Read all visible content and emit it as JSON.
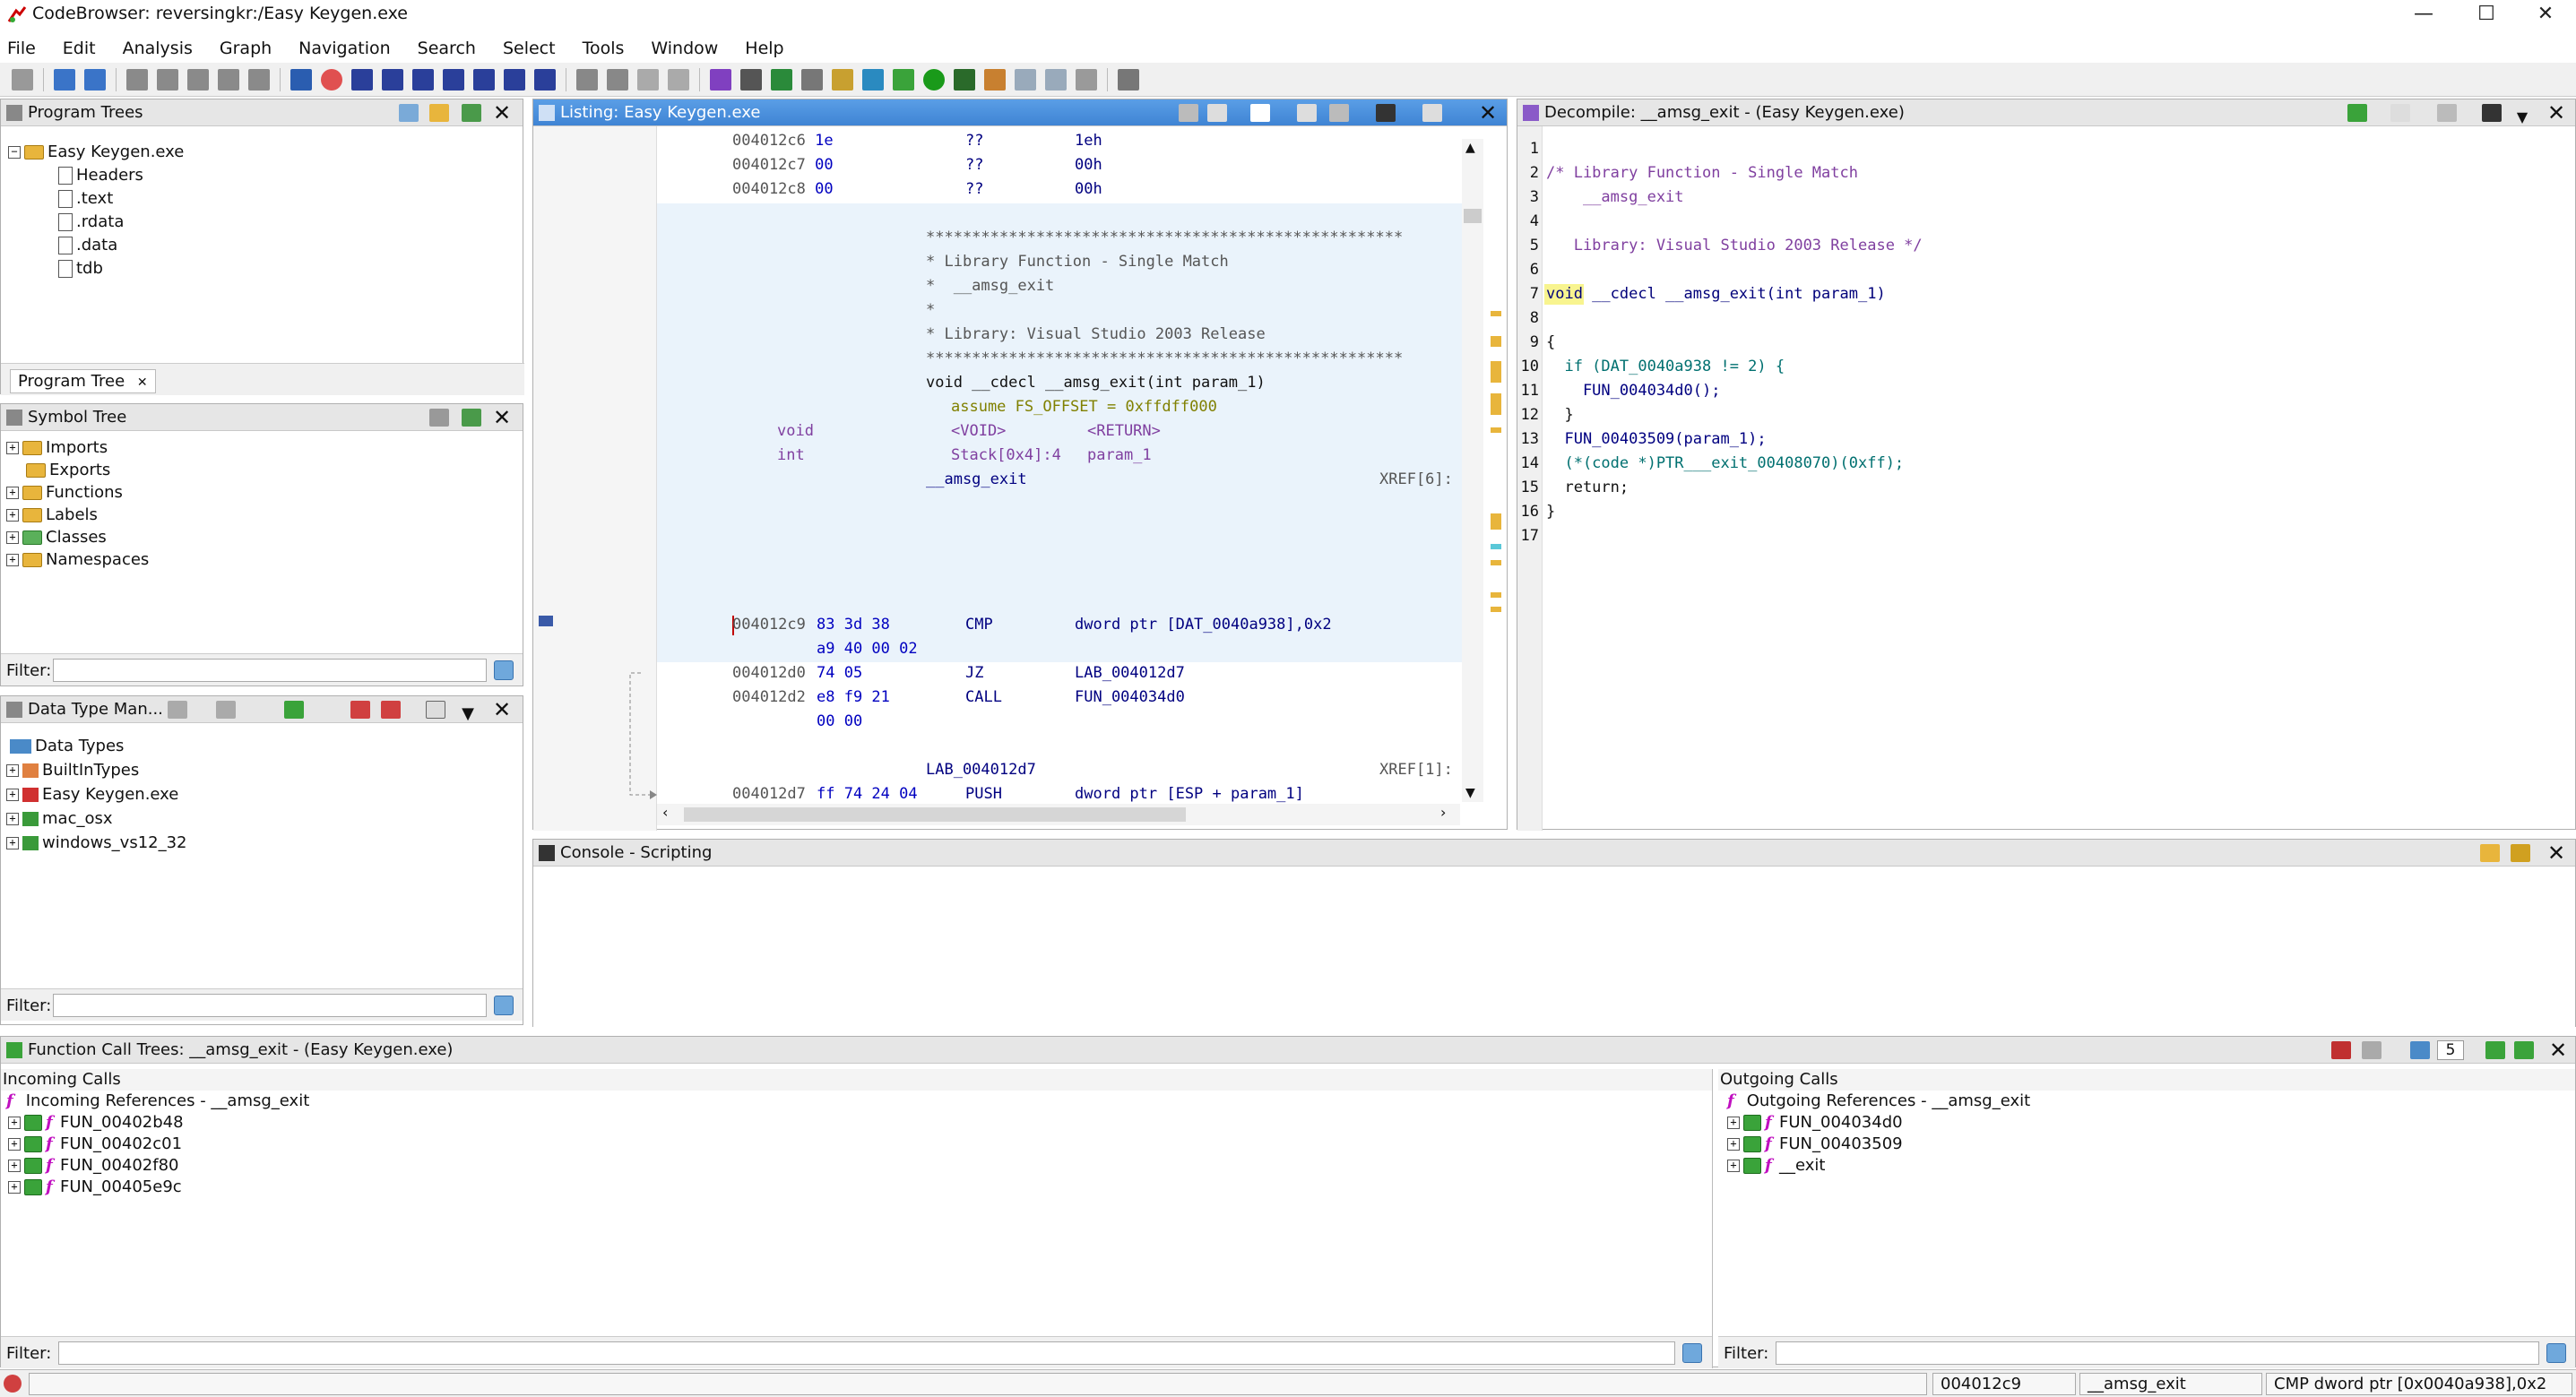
{
  "window": {
    "title": "CodeBrowser: reversingkr:/Easy Keygen.exe",
    "minimize": "—",
    "maximize": "☐",
    "close": "✕"
  },
  "menu": [
    "File",
    "Edit",
    "Analysis",
    "Graph",
    "Navigation",
    "Search",
    "Select",
    "Tools",
    "Window",
    "Help"
  ],
  "program_trees": {
    "title": "Program Trees",
    "root": "Easy Keygen.exe",
    "children": [
      "Headers",
      ".text",
      ".rdata",
      ".data",
      "tdb"
    ],
    "tab": "Program Tree"
  },
  "symbol_tree": {
    "title": "Symbol Tree",
    "items": [
      "Imports",
      "Exports",
      "Functions",
      "Labels",
      "Classes",
      "Namespaces"
    ],
    "filter_label": "Filter:"
  },
  "data_type_manager": {
    "title": "Data Type Man...",
    "root": "Data Types",
    "items": [
      "BuiltInTypes",
      "Easy Keygen.exe",
      "mac_osx",
      "windows_vs12_32"
    ],
    "filter_label": "Filter:"
  },
  "listing": {
    "title": "Listing:  Easy Keygen.exe",
    "top_rows": [
      {
        "addr": "004012c6",
        "bytes": "1e",
        "mnem": "??",
        "op": "1eh"
      },
      {
        "addr": "004012c7",
        "bytes": "00",
        "mnem": "??",
        "op": "00h"
      },
      {
        "addr": "004012c8",
        "bytes": "00",
        "mnem": "??",
        "op": "00h"
      }
    ],
    "stars": "****************************************************",
    "comment_lines": [
      "* Library Function - Single Match",
      "*  __amsg_exit",
      "*",
      "* Library: Visual Studio 2003 Release"
    ],
    "signature": "void __cdecl __amsg_exit(int param_1)",
    "assume": "assume FS_OFFSET = 0xffdff000",
    "var_rows": [
      {
        "type": "void",
        "storage": "<VOID>",
        "name": "<RETURN>"
      },
      {
        "type": "int",
        "storage": "Stack[0x4]:4",
        "name": "param_1"
      }
    ],
    "func_label": "__amsg_exit",
    "xref_main": "XREF[6]:",
    "code_rows": [
      {
        "addr": "004012c9",
        "bytes": "83 3d 38",
        "mnem": "CMP",
        "op": "dword ptr [DAT_0040a938],0x2",
        "cont": "a9 40 00 02"
      },
      {
        "addr": "004012d0",
        "bytes": "74 05",
        "mnem": "JZ",
        "op": "LAB_004012d7",
        "cont": ""
      },
      {
        "addr": "004012d2",
        "bytes": "e8 f9 21",
        "mnem": "CALL",
        "op": "FUN_004034d0",
        "cont": "00 00"
      }
    ],
    "lab_label": "LAB_004012d7",
    "xref_lab": "XREF[1]:",
    "last_row": {
      "addr": "004012d7",
      "bytes": "ff 74 24 04",
      "mnem": "PUSH",
      "op": "dword ptr [ESP + param_1]"
    }
  },
  "decompile": {
    "title": "Decompile: __amsg_exit -  (Easy Keygen.exe)",
    "lines": [
      "",
      "/* Library Function - Single Match",
      "    __amsg_exit",
      "",
      "   Library: Visual Studio 2003 Release */",
      "",
      "void __cdecl __amsg_exit(int param_1)",
      "",
      "{",
      "  if (DAT_0040a938 != 2) {",
      "    FUN_004034d0();",
      "  }",
      "  FUN_00403509(param_1);",
      "  (*(code *)PTR___exit_00408070)(0xff);",
      "  return;",
      "}",
      ""
    ]
  },
  "console": {
    "title": "Console - Scripting"
  },
  "fct": {
    "title": "Function Call Trees: __amsg_exit -  (Easy Keygen.exe)",
    "count": "5",
    "incoming_header": "Incoming Calls",
    "incoming_root": "Incoming References - __amsg_exit",
    "incoming": [
      "FUN_00402b48",
      "FUN_00402c01",
      "FUN_00402f80",
      "FUN_00405e9c"
    ],
    "outgoing_header": "Outgoing Calls",
    "outgoing_root": "Outgoing References - __amsg_exit",
    "outgoing": [
      "FUN_004034d0",
      "FUN_00403509",
      "__exit"
    ],
    "filter_label": "Filter:"
  },
  "status": {
    "addr": "004012c9",
    "func": "__amsg_exit",
    "instr": "CMP dword ptr [0x0040a938],0x2"
  },
  "colors": {
    "header_active": "#3f84d4",
    "listing_highlight": "#eaf3fb",
    "accent_orange": "#e8b53c",
    "string_purple": "#8040a0"
  }
}
